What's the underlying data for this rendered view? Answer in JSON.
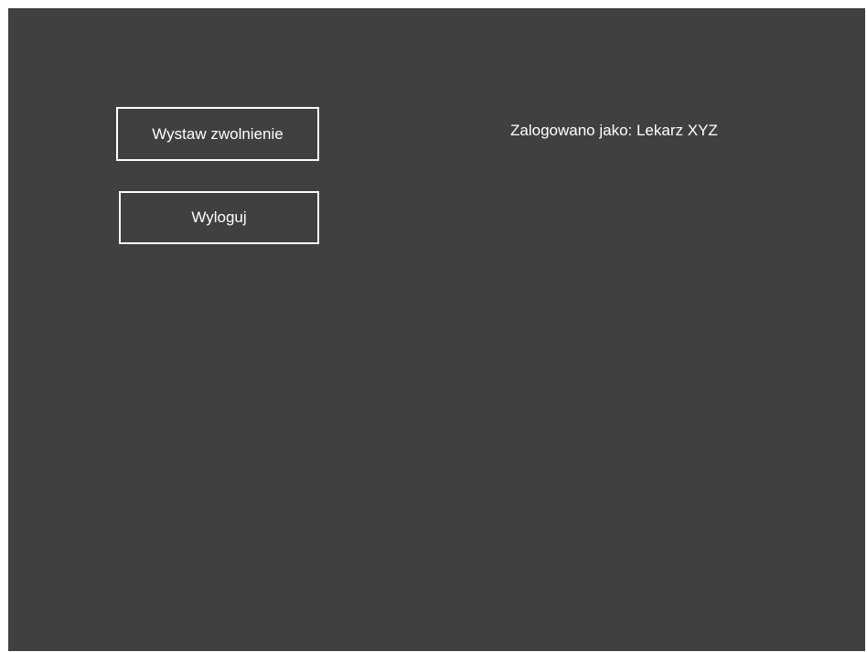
{
  "actions": {
    "issue_leave_label": "Wystaw zwolnienie",
    "logout_label": "Wyloguj"
  },
  "session": {
    "logged_in_as": "Zalogowano jako: Lekarz XYZ"
  },
  "colors": {
    "background": "#404040",
    "foreground": "#ffffff"
  }
}
